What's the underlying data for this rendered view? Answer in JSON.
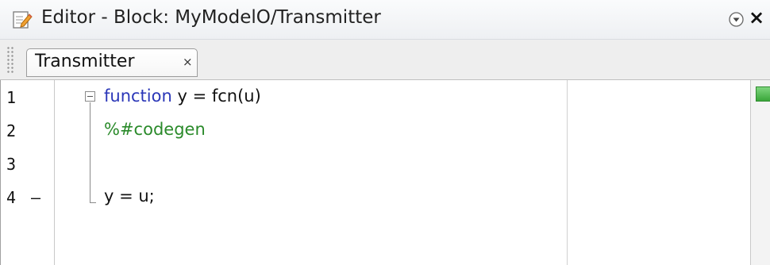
{
  "window": {
    "title": "Editor - Block: MyModelO/Transmitter",
    "close_glyph": "×",
    "menu_icon": "circle-chevron-down-icon",
    "title_icon": "edit-document-icon"
  },
  "tabs": [
    {
      "label": "Transmitter",
      "close_glyph": "×",
      "active": true
    }
  ],
  "editor": {
    "lines": [
      {
        "number": "1",
        "breakpoint_marker": "",
        "keyword": "function",
        "text": " y = fcn(u)"
      },
      {
        "number": "2",
        "breakpoint_marker": "",
        "comment": "%#codegen"
      },
      {
        "number": "3",
        "breakpoint_marker": ""
      },
      {
        "number": "4",
        "breakpoint_marker": "–",
        "text": "y = u;"
      }
    ]
  },
  "status_indicator": {
    "color": "#3aa63a",
    "state": "no-issues"
  },
  "colors": {
    "keyword": "#2b37b8",
    "comment": "#2a8a2a"
  }
}
